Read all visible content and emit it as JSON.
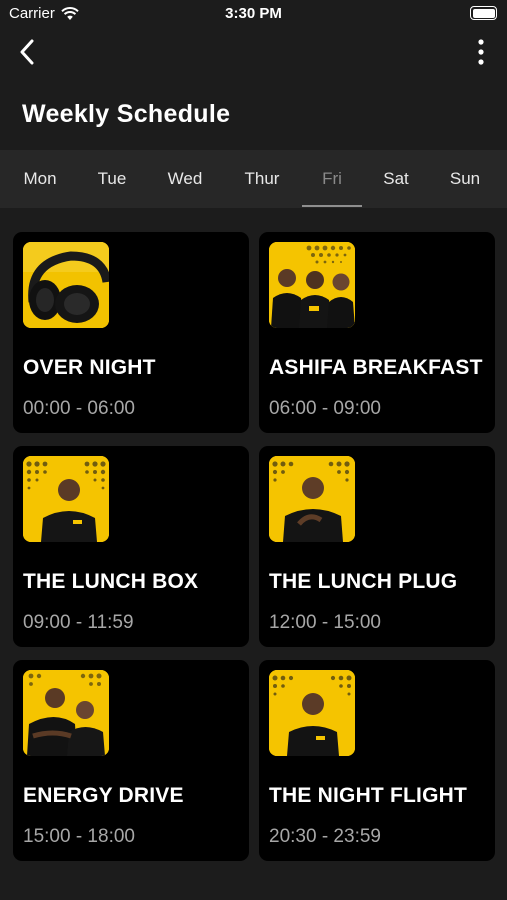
{
  "status_bar": {
    "carrier": "Carrier",
    "time": "3:30 PM"
  },
  "header": {
    "title": "Weekly Schedule",
    "back_icon": "chevron-left-icon",
    "more_icon": "more-vertical-icon"
  },
  "days": [
    {
      "label": "Mon",
      "active": false
    },
    {
      "label": "Tue",
      "active": false
    },
    {
      "label": "Wed",
      "active": false
    },
    {
      "label": "Thur",
      "active": false
    },
    {
      "label": "Fri",
      "active": true
    },
    {
      "label": "Sat",
      "active": false
    },
    {
      "label": "Sun",
      "active": false
    }
  ],
  "shows": [
    {
      "title": "OVER NIGHT",
      "time": "00:00 - 06:00",
      "image": "headphones-thumbnail"
    },
    {
      "title": "ASHIFA BREAKFAST",
      "time": "06:00 - 09:00",
      "image": "hosts-group-thumbnail"
    },
    {
      "title": "THE LUNCH BOX",
      "time": "09:00 - 11:59",
      "image": "host-thumbnail"
    },
    {
      "title": "THE LUNCH PLUG",
      "time": "12:00 - 15:00",
      "image": "host-thumbnail"
    },
    {
      "title": "ENERGY DRIVE",
      "time": "15:00 - 18:00",
      "image": "hosts-duo-thumbnail"
    },
    {
      "title": "THE NIGHT FLIGHT",
      "time": "20:30 - 23:59",
      "image": "host-thumbnail"
    }
  ],
  "colors": {
    "background": "#1c1c1c",
    "card": "#000000",
    "tab_bar": "#272727",
    "accent_yellow": "#f5c400",
    "muted_text": "#a7a7a7"
  }
}
